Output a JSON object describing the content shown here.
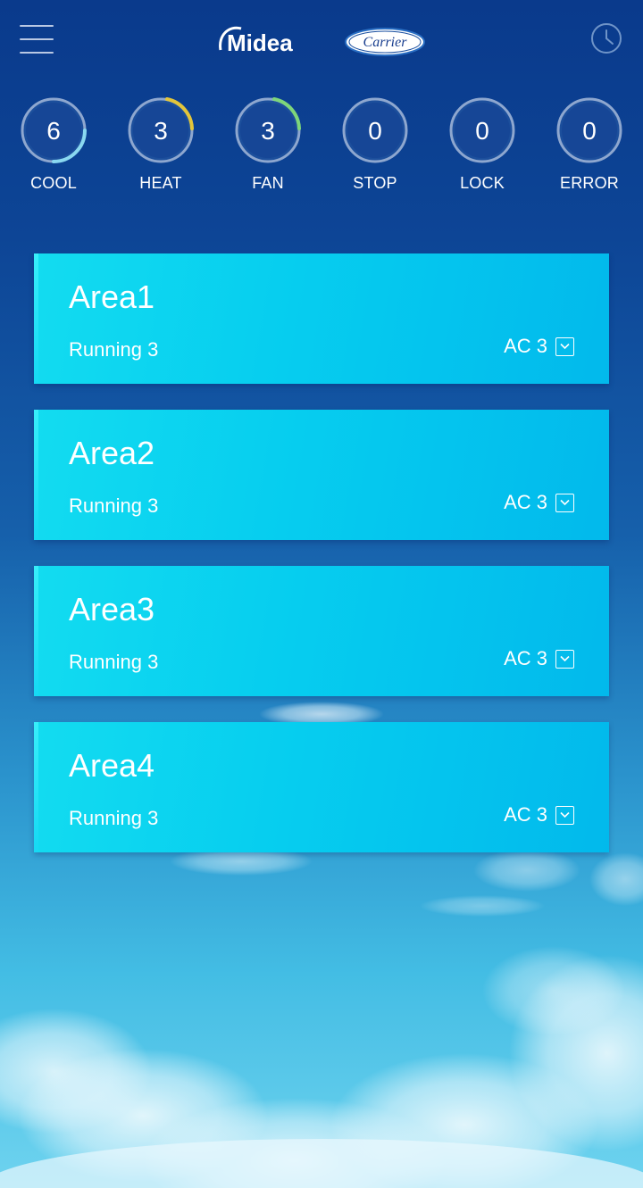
{
  "header": {
    "brand_left": "Midea",
    "brand_right": "Carrier"
  },
  "status": [
    {
      "label": "COOL",
      "count": "6",
      "accent": "#8ad8f0"
    },
    {
      "label": "HEAT",
      "count": "3",
      "accent": "#e3c53a"
    },
    {
      "label": "FAN",
      "count": "3",
      "accent": "#7ed67a"
    },
    {
      "label": "STOP",
      "count": "0",
      "accent": ""
    },
    {
      "label": "LOCK",
      "count": "0",
      "accent": ""
    },
    {
      "label": "ERROR",
      "count": "0",
      "accent": ""
    }
  ],
  "areas": [
    {
      "name": "Area1",
      "running": "Running 3",
      "ac": "AC 3"
    },
    {
      "name": "Area2",
      "running": "Running 3",
      "ac": "AC 3"
    },
    {
      "name": "Area3",
      "running": "Running 3",
      "ac": "AC 3"
    },
    {
      "name": "Area4",
      "running": "Running 3",
      "ac": "AC 3"
    }
  ],
  "colors": {
    "card": "#06cdef",
    "background_top": "#0a3a8c",
    "background_bottom": "#6fd3ef"
  }
}
